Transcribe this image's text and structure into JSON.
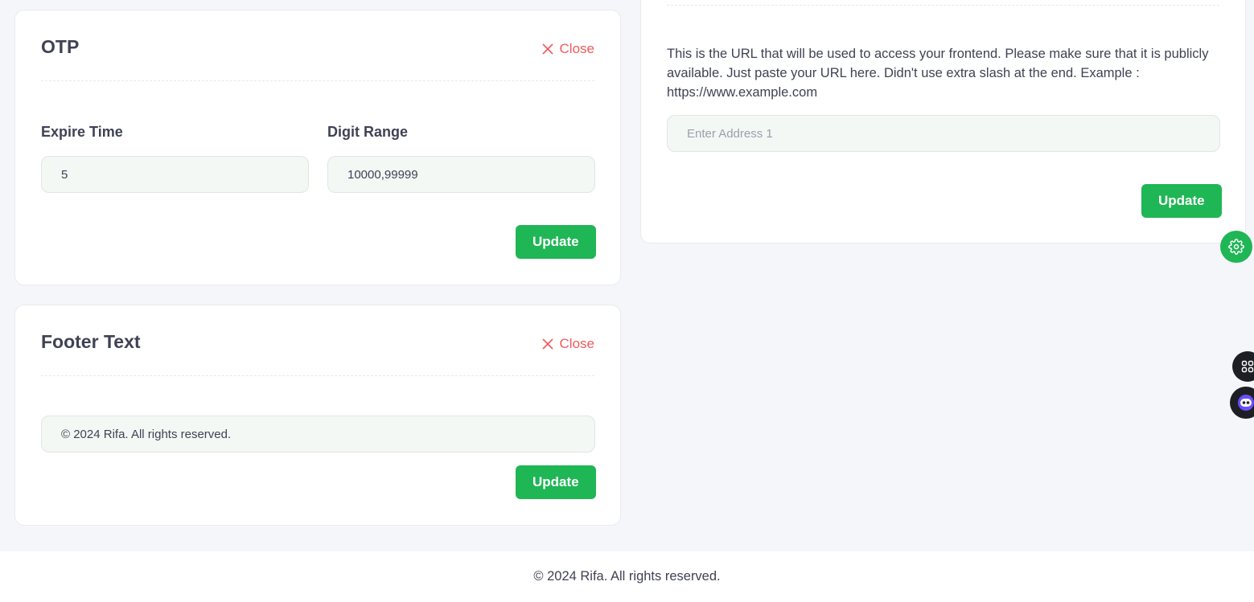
{
  "otp_card": {
    "title": "OTP",
    "close_label": "Close",
    "expire_time": {
      "label": "Expire Time",
      "value": "5"
    },
    "digit_range": {
      "label": "Digit Range",
      "value": "10000,99999"
    },
    "update_label": "Update"
  },
  "footer_text_card": {
    "title": "Footer Text",
    "close_label": "Close",
    "value": "© 2024 Rifa. All rights reserved.",
    "update_label": "Update"
  },
  "frontend_url_card": {
    "help_text": "This is the URL that will be used to access your frontend. Please make sure that it is publicly available. Just paste your URL here. Didn't use extra slash at the end. Example : https://www.example.com",
    "placeholder": "Enter Address 1",
    "value": "",
    "update_label": "Update"
  },
  "page_footer": {
    "text": "© 2024 Rifa. All rights reserved."
  },
  "floating_buttons": {
    "settings_icon": "gear-icon",
    "apps_icon": "grid-icon",
    "assistant_icon": "chat-bot-icon"
  },
  "colors": {
    "accent": "#1fb655",
    "danger": "#f1595c",
    "background": "#f5f6fa"
  }
}
